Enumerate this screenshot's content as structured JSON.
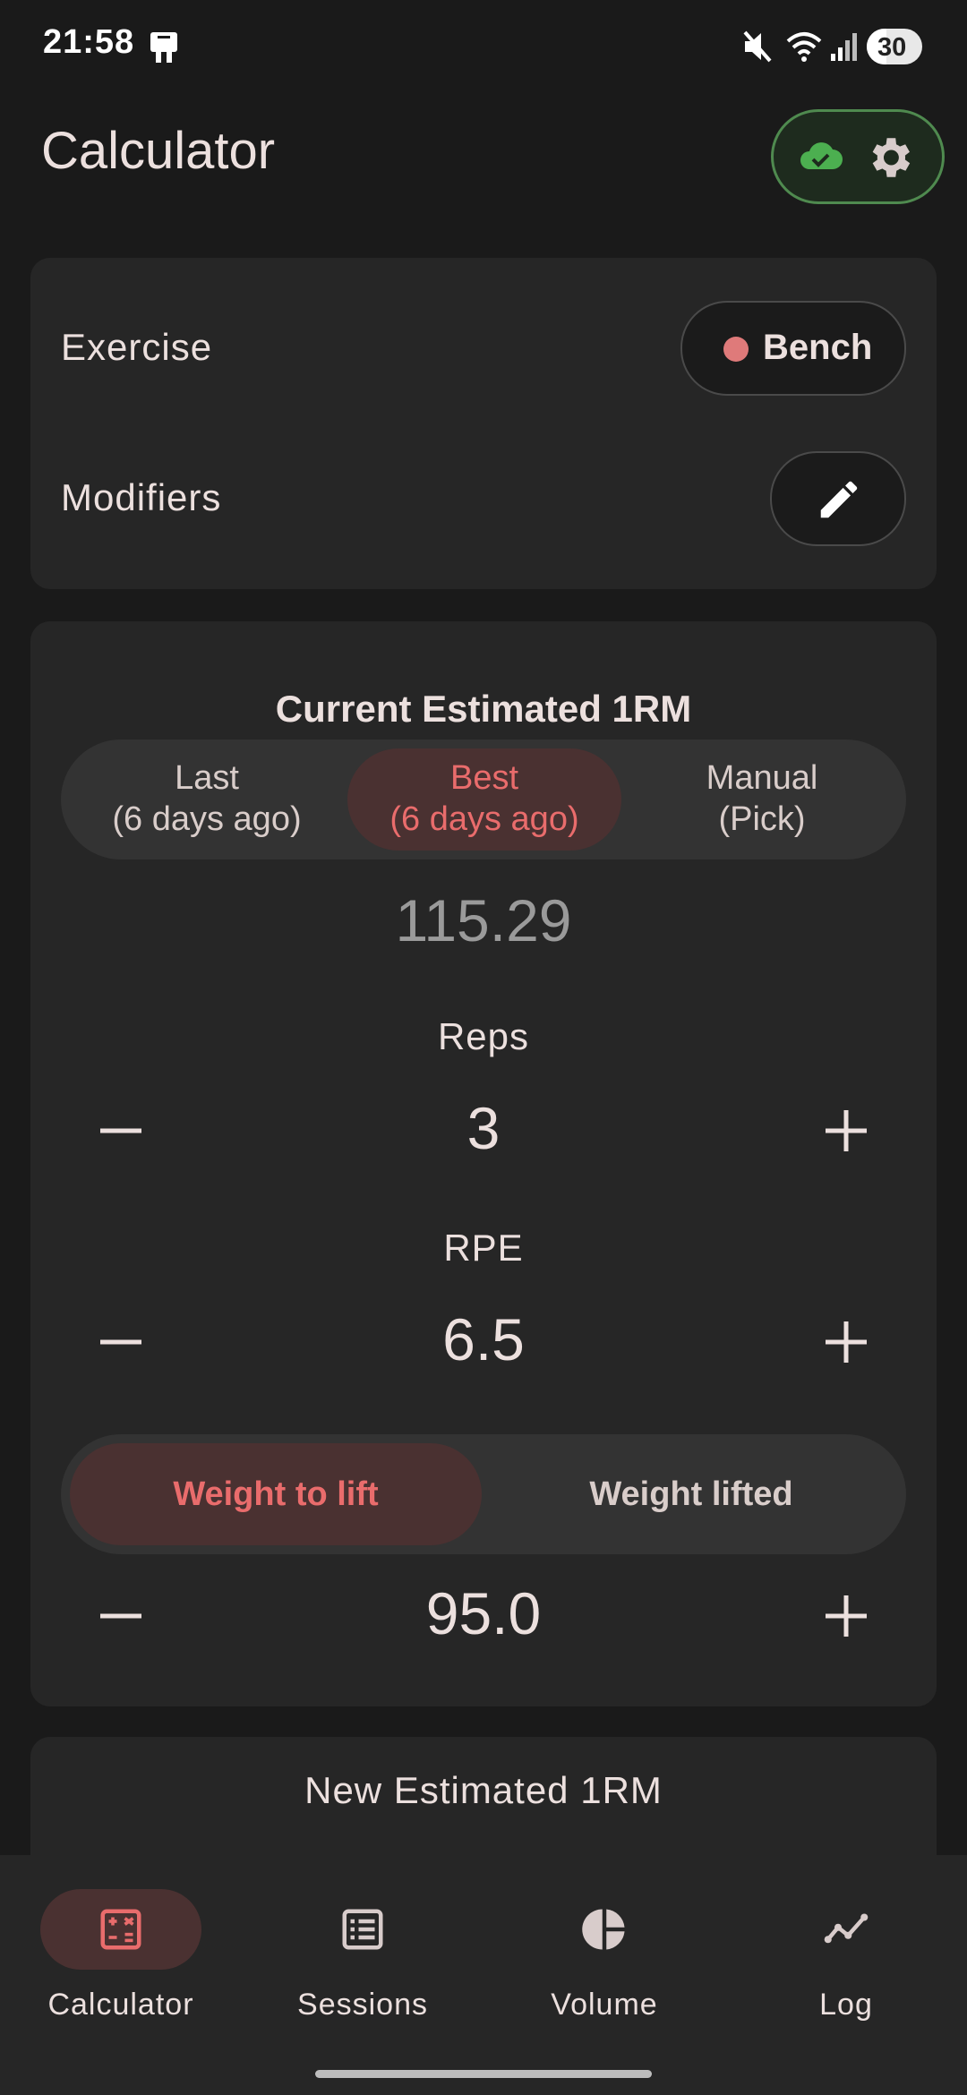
{
  "status_bar": {
    "time": "21:58",
    "battery": "30"
  },
  "app": {
    "title": "Calculator"
  },
  "exercise_card": {
    "exercise_label": "Exercise",
    "exercise_value": "Bench",
    "modifiers_label": "Modifiers"
  },
  "estimate_card": {
    "title": "Current Estimated 1RM",
    "segments": [
      {
        "line1": "Last",
        "line2": "(6 days ago)"
      },
      {
        "line1": "Best",
        "line2": "(6 days ago)"
      },
      {
        "line1": "Manual",
        "line2": "(Pick)"
      }
    ],
    "selected_segment": "Best",
    "estimated_value": "115.29",
    "reps_label": "Reps",
    "reps_value": "3",
    "rpe_label": "RPE",
    "rpe_value": "6.5",
    "weight_toggle": [
      "Weight to lift",
      "Weight lifted"
    ],
    "weight_value": "95.0"
  },
  "new_estimate_card": {
    "title": "New Estimated 1RM"
  },
  "bottom_nav": {
    "items": [
      {
        "label": "Calculator",
        "icon": "calculator-icon",
        "active": true
      },
      {
        "label": "Sessions",
        "icon": "list-icon",
        "active": false
      },
      {
        "label": "Volume",
        "icon": "pie-chart-icon",
        "active": false
      },
      {
        "label": "Log",
        "icon": "line-chart-icon",
        "active": false
      }
    ]
  },
  "colors": {
    "background": "#1a1a1a",
    "card": "#262626",
    "accent": "#e96c6c",
    "accent_bg": "#4a3131",
    "sync_green": "#4caf50"
  }
}
